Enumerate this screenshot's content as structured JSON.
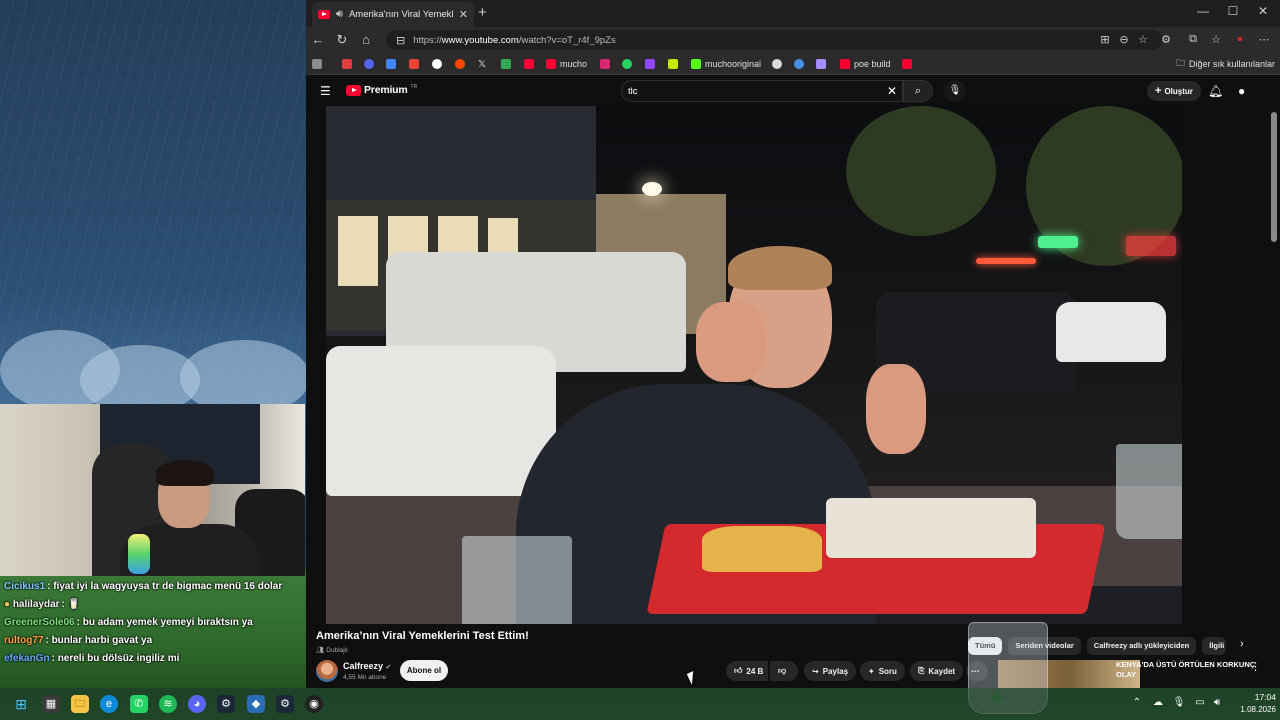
{
  "browser": {
    "tab_title": "Amerika'nın Viral Yemeklerini Test Ettim!",
    "url_prefix": "https://",
    "url_host": "www.youtube.com",
    "url_path": "/watch?v=oT_r4f_9pZs",
    "bookmarks": [
      {
        "label": "",
        "icon": "bookmark-1",
        "color": "#e23b3b"
      },
      {
        "label": "",
        "icon": "bookmark-2",
        "color": "#5865f2"
      },
      {
        "label": "",
        "icon": "bookmark-3",
        "color": "#4285f4"
      },
      {
        "label": "",
        "icon": "gmail-icon",
        "color": "#ea4335"
      },
      {
        "label": "",
        "icon": "google-icon",
        "color": "#ffffff"
      },
      {
        "label": "",
        "icon": "reddit-icon",
        "color": "#ff4500"
      },
      {
        "label": "",
        "icon": "x-icon",
        "color": "#ffffff"
      },
      {
        "label": "",
        "icon": "bookmark-8",
        "color": "#34a853"
      },
      {
        "label": "",
        "icon": "youtube-icon",
        "color": "#ff0033"
      },
      {
        "label": "mucho",
        "icon": "youtube-icon",
        "color": "#ff0033"
      },
      {
        "label": "",
        "icon": "instagram-icon",
        "color": "#d62976"
      },
      {
        "label": "",
        "icon": "whatsapp-icon",
        "color": "#25d366"
      },
      {
        "label": "",
        "icon": "twitch-icon",
        "color": "#9146ff"
      },
      {
        "label": "",
        "icon": "bookmark-14",
        "color": "#c5e600"
      },
      {
        "label": "muchooriginal",
        "icon": "kick-icon",
        "color": "#53fc18"
      },
      {
        "label": "",
        "icon": "bookmark-16",
        "color": "#dddddd"
      },
      {
        "label": "",
        "icon": "bookmark-17",
        "color": "#4a90e2"
      },
      {
        "label": "",
        "icon": "bookmark-18",
        "color": "#a58cff"
      },
      {
        "label": "poe build",
        "icon": "youtube-icon",
        "color": "#ff0033"
      },
      {
        "label": "",
        "icon": "youtube-icon",
        "color": "#ff0033"
      }
    ],
    "other_bookmarks": "Diğer sık kullanılanlar"
  },
  "youtube": {
    "logo_text": "Premium",
    "logo_sup": "TR",
    "search_value": "tlc",
    "create_label": "Oluştur",
    "video": {
      "title": "Amerika’nın Viral Yemeklerini Test Ettim!",
      "badge": "Dublajlı",
      "channel": "Calfreezy",
      "subscribers": "4,55 Mn abone",
      "subscribe_label": "Abone ol",
      "likes": "24 B",
      "share_label": "Paylaş",
      "ask_label": "Soru",
      "save_label": "Kaydet"
    },
    "chips": [
      {
        "label": "Tümü",
        "active": true
      },
      {
        "label": "Seriden videolar",
        "active": false
      },
      {
        "label": "Calfreezy adlı yükleyiciden",
        "active": false
      },
      {
        "label": "İlgili",
        "active": false
      }
    ],
    "recommendation": {
      "title": "KENYA'DA ÜSTÜ ÖRTÜLEN KORKUNÇ OLAY"
    }
  },
  "chat": [
    {
      "user": "Cicikus1",
      "color": "#7ec8ff",
      "message": "fiyat iyi la wagyuysa tr de bigmac menü 16 dolar"
    },
    {
      "user": "halilaydar",
      "color": "#f5f5f5",
      "message": "🥛",
      "badge": true
    },
    {
      "user": "GreenerSole06",
      "color": "#7ee07e",
      "message": "bu adam yemek yemeyi bıraktsın ya"
    },
    {
      "user": "rultog77",
      "color": "#ff9f40",
      "message": "bunlar harbi gavat ya"
    },
    {
      "user": "efekanGn",
      "color": "#6aa8ff",
      "message": "nereli bu dölsüz ingiliz mi"
    }
  ],
  "taskbar": {
    "time": "17:04",
    "date": "1.08.2026"
  }
}
